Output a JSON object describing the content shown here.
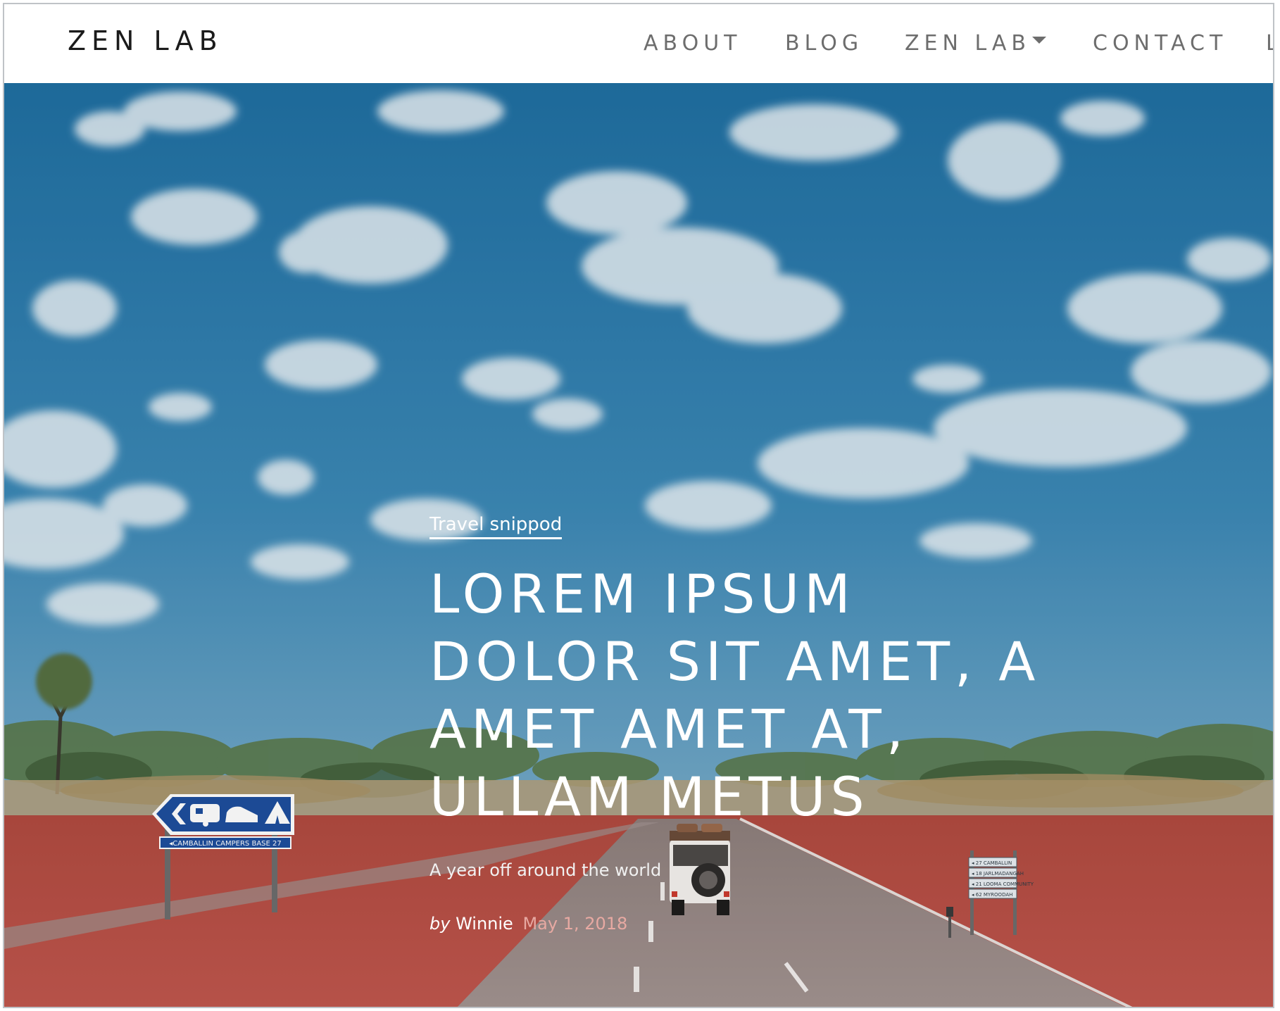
{
  "brand": "ZEN LAB",
  "nav": {
    "about": "ABOUT",
    "blog": "BLOG",
    "zenlab": "ZEN LAB",
    "contact": "CONTACT",
    "overflow_letter": "L"
  },
  "hero": {
    "category": "Travel snippod",
    "title": "LOREM IPSUM DOLOR SIT AMET, A AMET AMET AT, ULLAM METUS",
    "subtitle": "A year off around the world",
    "by": "by",
    "author": "Winnie",
    "date": "May 1, 2018",
    "sign_left_text": "◂CAMBALLIN CAMPERS BASE 27",
    "sign_right_lines": [
      "◂ 27 CAMBALLIN",
      "◂ 18 JARLMADANGAH",
      "◂ 21 LOOMA COMMUNITY",
      "◂ 62 MYROODAH"
    ]
  },
  "colors": {
    "sky_top": "#2a78a8",
    "sky_bottom": "#6fa6c4",
    "red_dirt": "#b54e44",
    "road": "#9a8a86",
    "sign_blue": "#1e4f9e",
    "date_color": "#e7a9a2"
  },
  "icons": {
    "caret": "caret-down-icon",
    "sign_arrow": "arrow-left-icon",
    "caravan": "caravan-icon",
    "car": "car-icon",
    "tent": "tent-icon"
  }
}
